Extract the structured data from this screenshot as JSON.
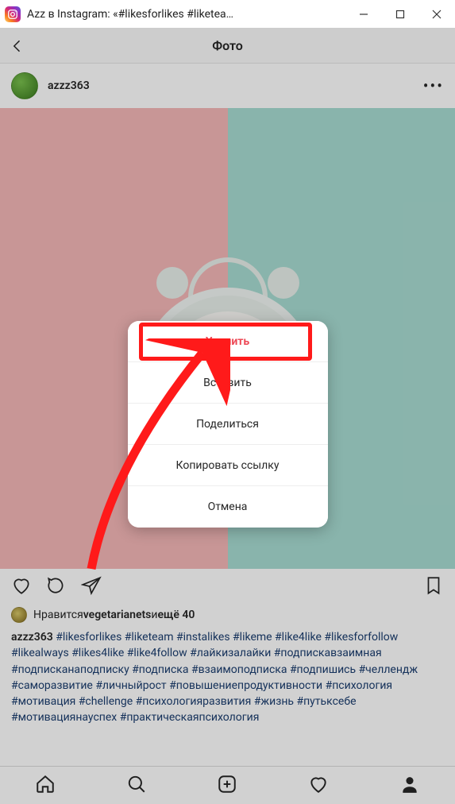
{
  "window": {
    "title": "Azz в Instagram: «#likesforlikes #liketea…"
  },
  "header": {
    "title": "Фото"
  },
  "post": {
    "username": "azzz363"
  },
  "likes": {
    "prefix": "Нравится ",
    "liker": "vegetarianets",
    "middle": " и ",
    "suffix": "ещё 40"
  },
  "caption": {
    "author": "azzz363",
    "tags": [
      "#likesforlikes",
      "#liketeam",
      "#instalikes",
      "#likeme",
      "#like4like",
      "#likesforfollow",
      "#likealways",
      "#likes4like",
      "#like4follow",
      "#лайкизалайки",
      "#подпискавзаимная",
      "#подписканаподписку",
      "#подписка",
      "#взаимоподписка",
      "#подпишись",
      "#челлендж",
      "#саморазвитие",
      "#личныйрост",
      "#повышениепродуктивности",
      "#психология",
      "#мотивация",
      "#chellenge",
      "#психологияразвития",
      "#жизнь",
      "#путьксебе",
      "#мотивациянауспех",
      "#практическаяпсихология"
    ]
  },
  "modal": {
    "delete": "Удалить",
    "embed": "Вставить",
    "share": "Поделиться",
    "copylink": "Копировать ссылку",
    "cancel": "Отмена"
  }
}
